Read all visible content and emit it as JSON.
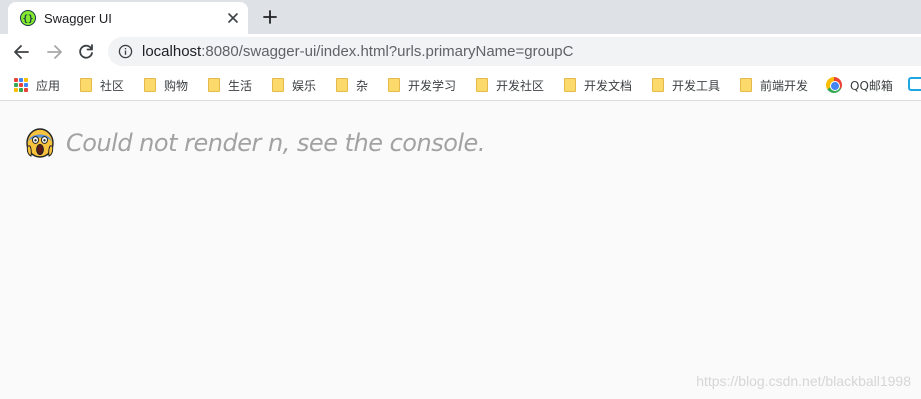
{
  "tab": {
    "title": "Swagger UI"
  },
  "address_bar": {
    "host": "localhost",
    "rest": ":8080/swagger-ui/index.html?urls.primaryName=groupC"
  },
  "bookmarks": [
    {
      "label": "应用",
      "icon": "apps-grid-icon"
    },
    {
      "label": "社区",
      "icon": "folder-icon"
    },
    {
      "label": "购物",
      "icon": "folder-icon"
    },
    {
      "label": "生活",
      "icon": "folder-icon"
    },
    {
      "label": "娱乐",
      "icon": "folder-icon"
    },
    {
      "label": "杂",
      "icon": "folder-icon"
    },
    {
      "label": "开发学习",
      "icon": "folder-icon"
    },
    {
      "label": "开发社区",
      "icon": "folder-icon"
    },
    {
      "label": "开发文档",
      "icon": "folder-icon"
    },
    {
      "label": "开发工具",
      "icon": "folder-icon"
    },
    {
      "label": "前端开发",
      "icon": "folder-icon"
    },
    {
      "label": "QQ邮箱",
      "icon": "qq-mail-icon"
    }
  ],
  "page": {
    "error_message": "Could not render n, see the console.",
    "error_icon": "screaming-face-emoji"
  },
  "watermark": "https://blog.csdn.net/blackball1998"
}
